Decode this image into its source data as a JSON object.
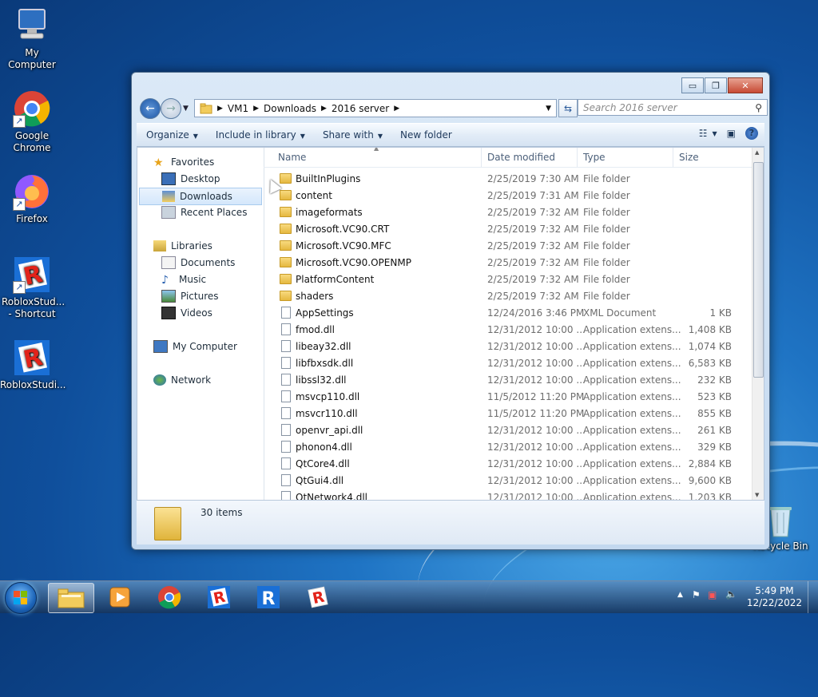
{
  "desktop": {
    "icons": [
      {
        "label": "My Computer"
      },
      {
        "label": "Google Chrome"
      },
      {
        "label": "Firefox"
      },
      {
        "label": "RobloxStud... - Shortcut"
      },
      {
        "label": "RobloxStudi..."
      },
      {
        "label": "Recycle Bin"
      }
    ]
  },
  "window": {
    "controls": {
      "minimize": "▭",
      "maximize": "❐",
      "close": "✕"
    },
    "address": {
      "crumbs": [
        "VM1",
        "Downloads",
        "2016 server"
      ]
    },
    "search_placeholder": "Search 2016 server",
    "toolbar": {
      "organize": "Organize",
      "include_in_library": "Include in library",
      "share_with": "Share with",
      "new_folder": "New folder"
    },
    "nav": {
      "favorites": "Favorites",
      "desktop": "Desktop",
      "downloads": "Downloads",
      "recent_places": "Recent Places",
      "libraries": "Libraries",
      "documents": "Documents",
      "music": "Music",
      "pictures": "Pictures",
      "videos": "Videos",
      "my_computer": "My Computer",
      "network": "Network"
    },
    "columns": {
      "name": "Name",
      "date": "Date modified",
      "type": "Type",
      "size": "Size"
    },
    "files": [
      {
        "name": "BuiltInPlugins",
        "date": "2/25/2019 7:30 AM",
        "type": "File folder",
        "size": "",
        "kind": "folder"
      },
      {
        "name": "content",
        "date": "2/25/2019 7:31 AM",
        "type": "File folder",
        "size": "",
        "kind": "folder"
      },
      {
        "name": "imageformats",
        "date": "2/25/2019 7:32 AM",
        "type": "File folder",
        "size": "",
        "kind": "folder"
      },
      {
        "name": "Microsoft.VC90.CRT",
        "date": "2/25/2019 7:32 AM",
        "type": "File folder",
        "size": "",
        "kind": "folder"
      },
      {
        "name": "Microsoft.VC90.MFC",
        "date": "2/25/2019 7:32 AM",
        "type": "File folder",
        "size": "",
        "kind": "folder"
      },
      {
        "name": "Microsoft.VC90.OPENMP",
        "date": "2/25/2019 7:32 AM",
        "type": "File folder",
        "size": "",
        "kind": "folder"
      },
      {
        "name": "PlatformContent",
        "date": "2/25/2019 7:32 AM",
        "type": "File folder",
        "size": "",
        "kind": "folder"
      },
      {
        "name": "shaders",
        "date": "2/25/2019 7:32 AM",
        "type": "File folder",
        "size": "",
        "kind": "folder"
      },
      {
        "name": "AppSettings",
        "date": "12/24/2016 3:46 PM",
        "type": "XML Document",
        "size": "1 KB",
        "kind": "file"
      },
      {
        "name": "fmod.dll",
        "date": "12/31/2012 10:00 ...",
        "type": "Application extens...",
        "size": "1,408 KB",
        "kind": "file"
      },
      {
        "name": "libeay32.dll",
        "date": "12/31/2012 10:00 ...",
        "type": "Application extens...",
        "size": "1,074 KB",
        "kind": "file"
      },
      {
        "name": "libfbxsdk.dll",
        "date": "12/31/2012 10:00 ...",
        "type": "Application extens...",
        "size": "6,583 KB",
        "kind": "file"
      },
      {
        "name": "libssl32.dll",
        "date": "12/31/2012 10:00 ...",
        "type": "Application extens...",
        "size": "232 KB",
        "kind": "file"
      },
      {
        "name": "msvcp110.dll",
        "date": "11/5/2012 11:20 PM",
        "type": "Application extens...",
        "size": "523 KB",
        "kind": "file"
      },
      {
        "name": "msvcr110.dll",
        "date": "11/5/2012 11:20 PM",
        "type": "Application extens...",
        "size": "855 KB",
        "kind": "file"
      },
      {
        "name": "openvr_api.dll",
        "date": "12/31/2012 10:00 ...",
        "type": "Application extens...",
        "size": "261 KB",
        "kind": "file"
      },
      {
        "name": "phonon4.dll",
        "date": "12/31/2012 10:00 ...",
        "type": "Application extens...",
        "size": "329 KB",
        "kind": "file"
      },
      {
        "name": "QtCore4.dll",
        "date": "12/31/2012 10:00 ...",
        "type": "Application extens...",
        "size": "2,884 KB",
        "kind": "file"
      },
      {
        "name": "QtGui4.dll",
        "date": "12/31/2012 10:00 ...",
        "type": "Application extens...",
        "size": "9,600 KB",
        "kind": "file"
      },
      {
        "name": "QtNetwork4.dll",
        "date": "12/31/2012 10:00 ...",
        "type": "Application extens...",
        "size": "1,203 KB",
        "kind": "file"
      }
    ],
    "status": {
      "items": "30 items"
    }
  },
  "taskbar": {
    "clock": {
      "time": "5:49 PM",
      "date": "12/22/2022"
    }
  }
}
